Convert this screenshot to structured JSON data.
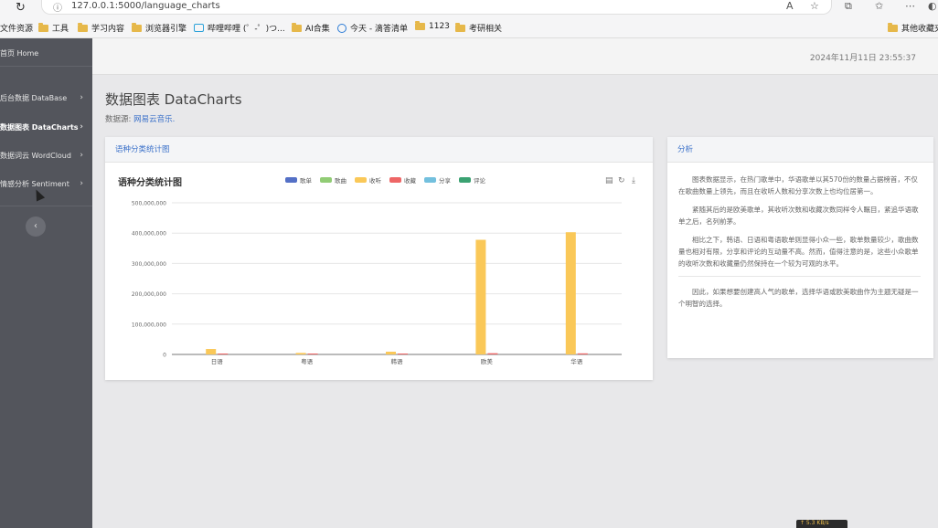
{
  "browser": {
    "url": "127.0.0.1:5000/language_charts",
    "bookmarks": [
      "文件资源",
      "工具",
      "学习内容",
      "浏览器引擎",
      "哔哩哔哩 (゜-゜)つ...",
      "AI合集",
      "今天 - 滴答清单",
      "1123",
      "考研相关",
      "其他收藏夹"
    ]
  },
  "sidebar": {
    "items": [
      {
        "label": "首页 Home"
      },
      {
        "label": "后台数据 DataBase"
      },
      {
        "label": "数据图表 DataCharts"
      },
      {
        "label": "数据词云 WordCloud"
      },
      {
        "label": "情感分析 Sentiment"
      }
    ],
    "collapse_icon": "chevron-left"
  },
  "header": {
    "timestamp": "2024年11月11日 23:55:37"
  },
  "page": {
    "title": "数据图表 DataCharts",
    "source_prefix": "数据源: ",
    "source_link": "网易云音乐."
  },
  "chart_panel": {
    "header": "语种分类统计图"
  },
  "chart_data": {
    "type": "bar",
    "title": "语种分类统计图",
    "categories": [
      "日语",
      "粤语",
      "韩语",
      "欧美",
      "华语"
    ],
    "series": [
      {
        "name": "歌单",
        "color": "#5470c6",
        "values": [
          0,
          0,
          0,
          0,
          0
        ]
      },
      {
        "name": "歌曲",
        "color": "#91cc75",
        "values": [
          0,
          0,
          0,
          0,
          0
        ]
      },
      {
        "name": "收听",
        "color": "#fac858",
        "values": [
          18000000,
          5000000,
          9000000,
          378000000,
          403000000
        ]
      },
      {
        "name": "收藏",
        "color": "#ee6666",
        "values": [
          500000,
          200000,
          300000,
          4000000,
          3500000
        ]
      },
      {
        "name": "分享",
        "color": "#73c0de",
        "values": [
          0,
          0,
          0,
          0,
          0
        ]
      },
      {
        "name": "评论",
        "color": "#3ba272",
        "values": [
          0,
          0,
          0,
          0,
          0
        ]
      }
    ],
    "yticks": [
      "0",
      "100,000,000",
      "200,000,000",
      "300,000,000",
      "400,000,000",
      "500,000,000"
    ],
    "ylim": [
      0,
      500000000
    ]
  },
  "analysis_panel": {
    "header": "分析",
    "paragraphs": [
      "图表数据显示，在热门歌单中，华语歌单以其570份的数量占据榜首，不仅在歌曲数量上领先，而且在收听人数和分享次数上也均位居第一。",
      "紧随其后的是欧美歌单，其收听次数和收藏次数同样令人瞩目，紧追华语歌单之后，名列前茅。",
      "相比之下，韩语、日语和粤语歌单则显得小众一些，歌单数量较少，歌曲数量也相对有限，分享和评论的互动量不高。然而，值得注意的是，这些小众歌单的收听次数和收藏量仍然保持在一个较为可观的水平。",
      "因此，如果想要创建高人气的歌单，选择华语或欧美歌曲作为主题无疑是一个明智的选择。"
    ]
  },
  "badge": {
    "text": "↑ 5.3 KB/s"
  }
}
